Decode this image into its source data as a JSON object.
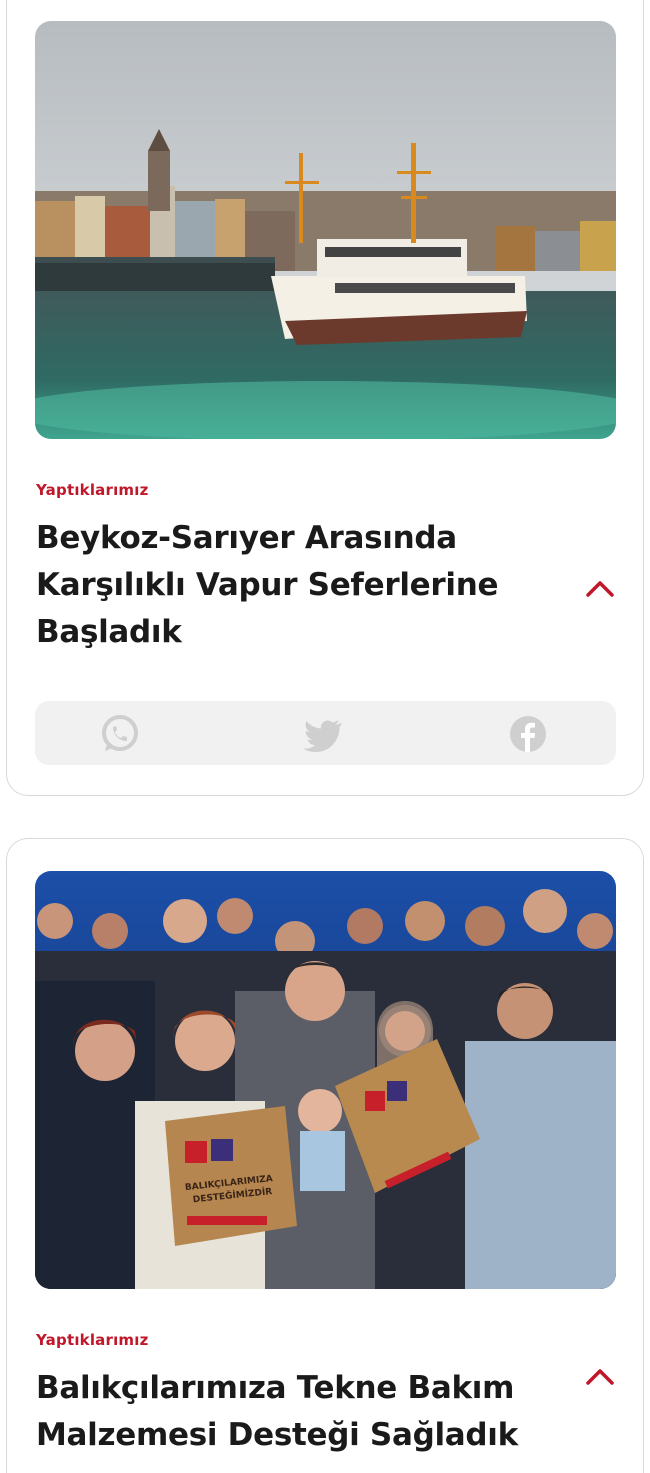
{
  "cards": [
    {
      "category": "Yaptıklarımız",
      "title": "Beykoz-Sarıyer Arasında Karşılıklı Vapur Seferlerine Başladık",
      "image": "ferry-bosphorus-photo",
      "share": [
        "whatsapp-icon",
        "twitter-icon",
        "facebook-icon"
      ]
    },
    {
      "category": "Yaptıklarımız",
      "title": "Balıkçılarımıza Tekne Bakım Malzemesi Desteği Sağladık",
      "image": "group-photo-with-boxes",
      "box_label_line1": "BALIKÇILARIMIZA",
      "box_label_line2": "DESTEĞİMİZDİR"
    }
  ],
  "colors": {
    "accent": "#c0172a",
    "title": "#1a1a1a",
    "share_bar_bg": "#f1f1f1",
    "share_icon": "#cfcfcf"
  }
}
